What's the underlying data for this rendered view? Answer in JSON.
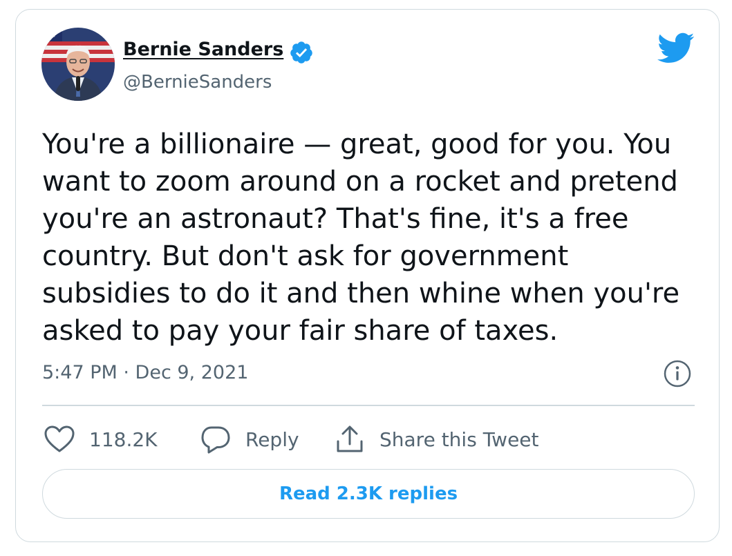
{
  "author": {
    "name": "Bernie Sanders",
    "handle": "@BernieSanders",
    "verified_icon": "verified-badge-icon",
    "avatar": "profile-photo"
  },
  "brand": {
    "icon": "twitter-bird-icon",
    "color": "#1d9bf0"
  },
  "tweet": {
    "text": "You're a billionaire — great, good for you. You\nwant to zoom around on a rocket and pretend\nyou're an astronaut? That's fine, it's a free\ncountry. But don't ask for government\nsubsidies to do it and then whine when you're\nasked to pay your fair share of taxes.",
    "timestamp": "5:47 PM · Dec 9, 2021"
  },
  "actions": {
    "like_count": "118.2K",
    "reply_label": "Reply",
    "share_label": "Share this Tweet"
  },
  "footer": {
    "read_replies_label": "Read 2.3K replies"
  },
  "colors": {
    "text_primary": "#0f1419",
    "text_secondary": "#536471",
    "border": "#cfd9de",
    "accent": "#1d9bf0"
  }
}
